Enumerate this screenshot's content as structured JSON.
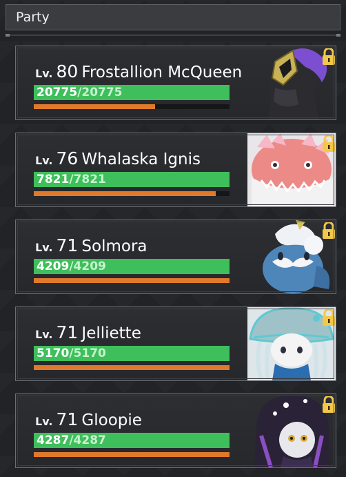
{
  "header": {
    "title": "Party"
  },
  "party": [
    {
      "lv_label": "Lv.",
      "level": "80",
      "name": "Frostallion McQueen",
      "hp_current": "20775",
      "hp_max": "/20775",
      "stamina": 0.62,
      "portrait": "dark-horse-creature"
    },
    {
      "lv_label": "Lv.",
      "level": "76",
      "name": "Whalaska Ignis",
      "hp_current": "7821",
      "hp_max": "/7821",
      "stamina": 0.93,
      "portrait": "pink-whale-creature"
    },
    {
      "lv_label": "Lv.",
      "level": "71",
      "name": "Solmora",
      "hp_current": "4209",
      "hp_max": "/4209",
      "stamina": 1.0,
      "portrait": "blue-seal-creature"
    },
    {
      "lv_label": "Lv.",
      "level": "71",
      "name": "Jelliette",
      "hp_current": "5170",
      "hp_max": "/5170",
      "stamina": 1.0,
      "portrait": "jellyfish-girl-creature"
    },
    {
      "lv_label": "Lv.",
      "level": "71",
      "name": "Gloopie",
      "hp_current": "4287",
      "hp_max": "/4287",
      "stamina": 1.0,
      "portrait": "slime-girl-creature"
    }
  ],
  "colors": {
    "hp": "#3fbf5b",
    "stamina": "#e07a2a",
    "lock": "#f2c84b"
  }
}
